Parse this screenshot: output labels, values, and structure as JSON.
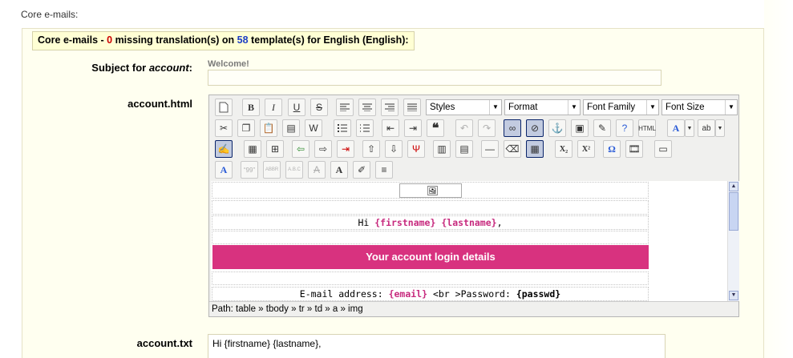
{
  "page": {
    "section_label": "Core e-mails:"
  },
  "legend": {
    "prefix": "Core e-mails - ",
    "missing_count": "0",
    "middle": " missing translation(s) on ",
    "template_count": "58",
    "suffix": " template(s) for English (English):"
  },
  "subject": {
    "label_prefix": "Subject for ",
    "label_name": "account",
    "label_colon": ":",
    "hint": "Welcome!",
    "value": ""
  },
  "html_field": {
    "label": "account.html"
  },
  "toolbar": {
    "styles": "Styles",
    "format": "Format",
    "font_family": "Font Family",
    "font_size": "Font Size"
  },
  "content": {
    "greeting_hi": "Hi ",
    "firstname": "{firstname}",
    "lastname": "{lastname}",
    "comma": ",",
    "banner": "Your account login details",
    "email_label": "E-mail address: ",
    "email_var": "{email}",
    "br_text": " <br >Password: ",
    "passwd_var": "{passwd}"
  },
  "path": {
    "text": "Path: table » tbody » tr » td » a » img"
  },
  "txt_field": {
    "label": "account.txt",
    "value": "Hi {firstname} {lastname},"
  }
}
